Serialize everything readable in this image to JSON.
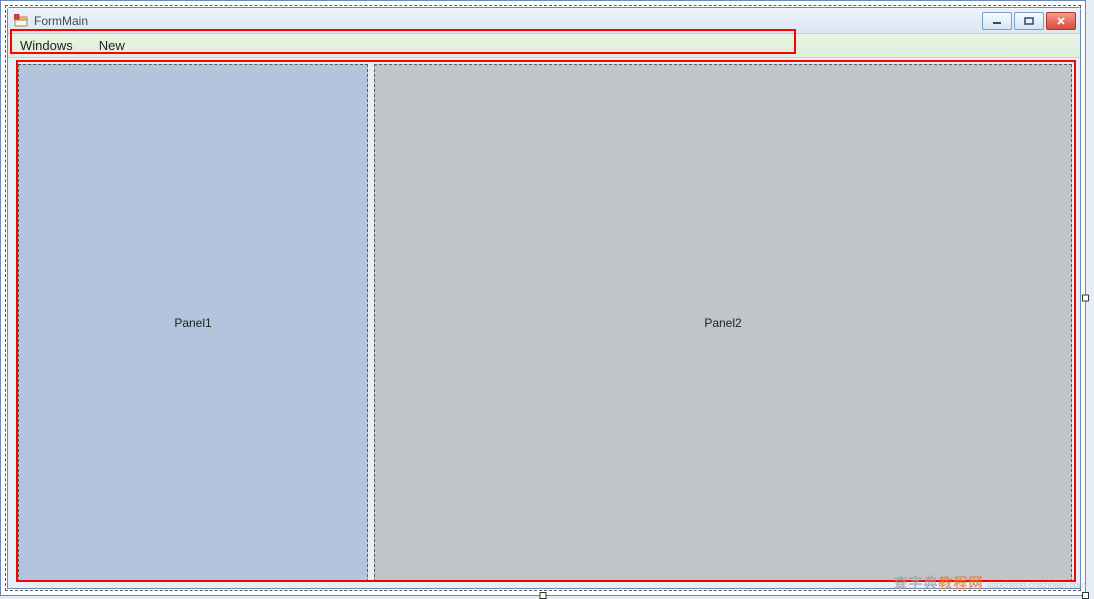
{
  "window": {
    "title": "FormMain"
  },
  "menu": {
    "items": [
      {
        "label": "Windows"
      },
      {
        "label": "New"
      }
    ]
  },
  "split": {
    "panel1_label": "Panel1",
    "panel2_label": "Panel2"
  },
  "watermark": {
    "line1_a": "查字典",
    "line1_b": "教程网",
    "line2": "jiaocheng.chazidian.com"
  },
  "colors": {
    "panel1_bg": "#b2c5dc",
    "panel2_bg": "#c1c5ca",
    "annotation": "#ff0000"
  }
}
